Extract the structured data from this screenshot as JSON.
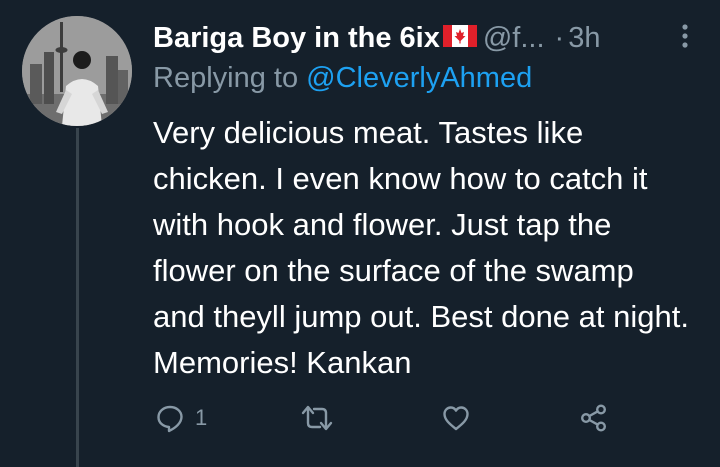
{
  "tweet": {
    "display_name": "Bariga Boy in the 6ix",
    "flag_icon": "canada-flag-icon",
    "handle": "@f...",
    "dot": "·",
    "time": "3h",
    "replying_prefix": "Replying to ",
    "replying_to": "@CleverlyAhmed",
    "text": "Very delicious meat. Tastes like chicken. I even know how to catch it with hook and flower. Just tap the flower on the surface of the swamp and theyll jump out. Best done at night. Memories! Kankan",
    "actions": {
      "reply_count": "1",
      "retweet_count": "",
      "like_count": ""
    }
  },
  "colors": {
    "background": "#15202b",
    "secondary_text": "#8899a6",
    "link": "#1da1f2",
    "thread_line": "#38444d"
  }
}
